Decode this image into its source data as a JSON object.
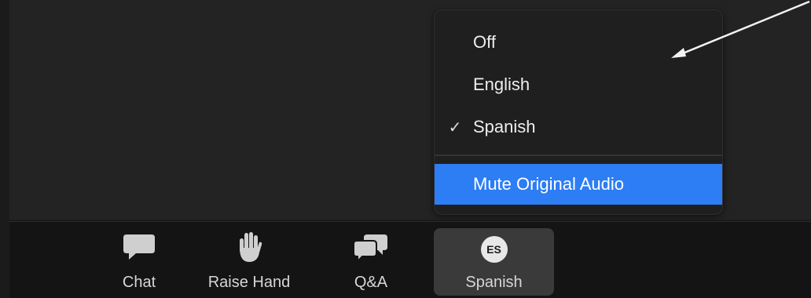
{
  "menu": {
    "items": [
      {
        "label": "Off",
        "checked": false
      },
      {
        "label": "English",
        "checked": false
      },
      {
        "label": "Spanish",
        "checked": true
      }
    ],
    "mute_label": "Mute Original Audio",
    "check_glyph": "✓",
    "highlight_color": "#2d7df4"
  },
  "toolbar": {
    "chat": {
      "label": "Chat",
      "icon": "chat-bubble-icon"
    },
    "raise_hand": {
      "label": "Raise Hand",
      "icon": "hand-icon"
    },
    "qa": {
      "label": "Q&A",
      "icon": "qa-bubbles-icon"
    },
    "language": {
      "label": "Spanish",
      "badge": "ES",
      "icon": "language-badge-icon"
    }
  }
}
